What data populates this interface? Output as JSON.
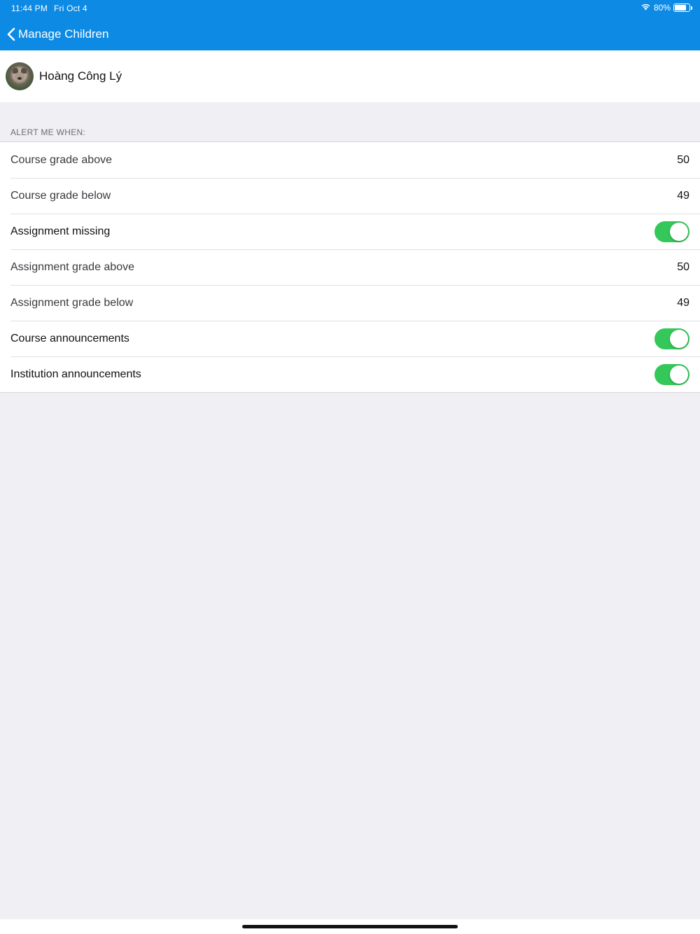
{
  "status_bar": {
    "time": "11:44 PM",
    "date": "Fri Oct 4",
    "battery": "80%",
    "battery_level": 0.8
  },
  "nav": {
    "back_label": "Manage Children"
  },
  "profile": {
    "name": "Hoàng Công Lý"
  },
  "section": {
    "header": "ALERT ME WHEN:"
  },
  "rows": [
    {
      "label": "Course grade above",
      "value": "50"
    },
    {
      "label": "Course grade below",
      "value": "49"
    },
    {
      "label": "Assignment missing",
      "toggle_on": true
    },
    {
      "label": "Assignment grade above",
      "value": "50"
    },
    {
      "label": "Assignment grade below",
      "value": "49"
    },
    {
      "label": "Course announcements",
      "toggle_on": true
    },
    {
      "label": "Institution announcements",
      "toggle_on": true
    }
  ],
  "colors": {
    "header_bg": "#0d8ae4",
    "toggle_on": "#34c759",
    "page_bg": "#efeff4"
  }
}
